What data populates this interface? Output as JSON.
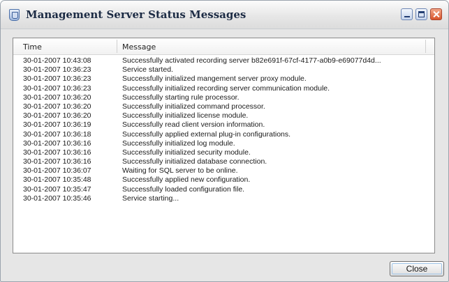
{
  "window": {
    "title": "Management Server Status Messages"
  },
  "list": {
    "columns": {
      "time": "Time",
      "message": "Message"
    },
    "rows": [
      {
        "time": "30-01-2007 10:43:08",
        "message": "Successfully activated recording server b82e691f-67cf-4177-a0b9-e69077d4d..."
      },
      {
        "time": "30-01-2007 10:36:23",
        "message": "Service started."
      },
      {
        "time": "30-01-2007 10:36:23",
        "message": "Successfully initialized mangement server proxy module."
      },
      {
        "time": "30-01-2007 10:36:23",
        "message": "Successfully initialized recording server communication module."
      },
      {
        "time": "30-01-2007 10:36:20",
        "message": "Successfully starting rule processor."
      },
      {
        "time": "30-01-2007 10:36:20",
        "message": "Successfully initialized command processor."
      },
      {
        "time": "30-01-2007 10:36:20",
        "message": "Successfully initialized license module."
      },
      {
        "time": "30-01-2007 10:36:19",
        "message": "Successfully read client version information."
      },
      {
        "time": "30-01-2007 10:36:18",
        "message": "Successfully applied external plug-in configurations."
      },
      {
        "time": "30-01-2007 10:36:16",
        "message": "Successfully initialized log module."
      },
      {
        "time": "30-01-2007 10:36:16",
        "message": "Successfully initialized security module."
      },
      {
        "time": "30-01-2007 10:36:16",
        "message": "Successfully initialized database connection."
      },
      {
        "time": "30-01-2007 10:36:07",
        "message": "Waiting for SQL server to be online."
      },
      {
        "time": "30-01-2007 10:35:48",
        "message": "Successfully applied new configuration."
      },
      {
        "time": "30-01-2007 10:35:47",
        "message": "Successfully loaded configuration file."
      },
      {
        "time": "30-01-2007 10:35:46",
        "message": "Service starting..."
      }
    ]
  },
  "footer": {
    "close_label": "Close"
  }
}
